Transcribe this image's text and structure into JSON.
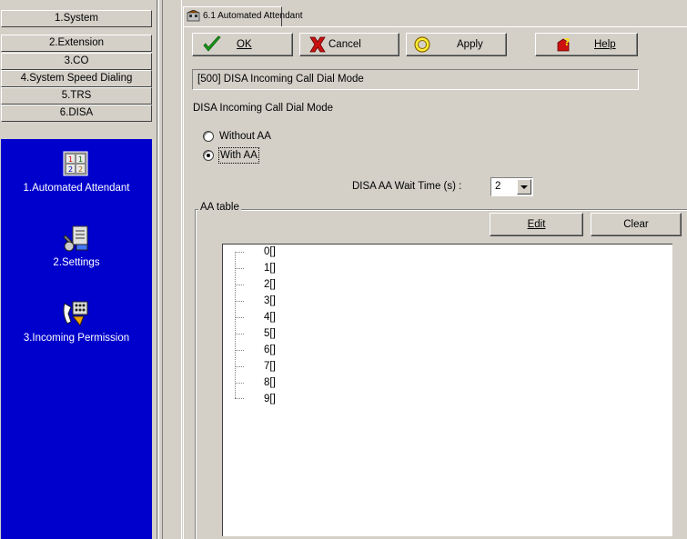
{
  "sidebar": {
    "nav": [
      {
        "label": "1.System"
      },
      {
        "label": "2.Extension"
      },
      {
        "label": "3.CO"
      },
      {
        "label": "4.System Speed Dialing"
      },
      {
        "label": "5.TRS"
      },
      {
        "label": "6.DISA"
      }
    ],
    "panel_items": [
      {
        "label": "1.Automated Attendant",
        "icon": "automated-attendant-icon"
      },
      {
        "label": "2.Settings",
        "icon": "settings-icon"
      },
      {
        "label": "3.Incoming Permission",
        "icon": "incoming-permission-icon"
      }
    ],
    "panel_color": "#0000cc"
  },
  "tab": {
    "label": "6.1 Automated Attendant",
    "icon": "building-icon"
  },
  "toolbar": {
    "ok_label": "OK",
    "cancel_label": "Cancel",
    "apply_label": "Apply",
    "help_label": "Help"
  },
  "title_field": {
    "value": "[500] DISA Incoming Call Dial Mode"
  },
  "mode": {
    "label": "DISA Incoming Call Dial Mode",
    "options": [
      {
        "label": "Without AA",
        "selected": false
      },
      {
        "label": "With AA",
        "selected": true
      }
    ]
  },
  "wait_time": {
    "label": "DISA AA Wait Time (s) :",
    "value": "2"
  },
  "aa_table": {
    "label": "AA table",
    "edit_label": "Edit",
    "clear_label": "Clear",
    "items": [
      "0[]",
      "1[]",
      "2[]",
      "3[]",
      "4[]",
      "5[]",
      "6[]",
      "7[]",
      "8[]",
      "9[]"
    ]
  }
}
